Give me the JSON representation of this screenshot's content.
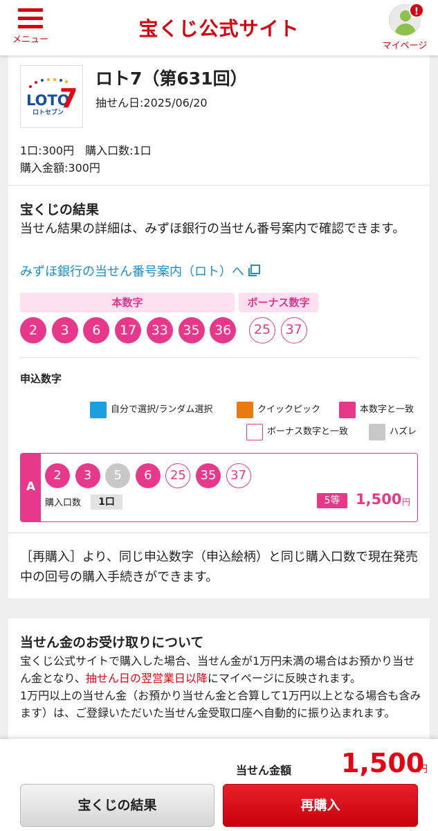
{
  "header": {
    "menu_label": "メニュー",
    "site_title": "宝くじ公式サイト",
    "mypage_label": "マイページ",
    "notification_badge": "!",
    "brand_color": "#d7000f"
  },
  "product": {
    "logo_text": "LOTO7",
    "logo_subtext": "ロトセブン",
    "title": "ロト7（第631回）",
    "draw_date": "抽せん日:2025/06/20",
    "price_line1": "1口:300円　購入口数:1口",
    "price_line2": "購入金額:300円"
  },
  "result": {
    "section_title": "宝くじの結果",
    "description": "当せん結果の詳細は、みずほ銀行の当せん番号案内で確認できます。",
    "link_text": "みずほ銀行の当せん番号案内（ロト）へ",
    "main_label": "本数字",
    "bonus_label": "ボーナス数字",
    "main_numbers": [
      "2",
      "3",
      "6",
      "17",
      "33",
      "35",
      "36"
    ],
    "bonus_numbers": [
      "25",
      "37"
    ]
  },
  "application": {
    "title": "申込数字",
    "legend": [
      {
        "label": "自分で選択/ランダム選択",
        "color": "#1a9fe0",
        "style": "fill"
      },
      {
        "label": "クイックピック",
        "color": "#e87a10",
        "style": "fill"
      },
      {
        "label": "本数字と一致",
        "color": "#e8388c",
        "style": "fill"
      },
      {
        "label": "ボーナス数字と一致",
        "color": "#e8388c",
        "style": "outline"
      },
      {
        "label": "ハズレ",
        "color": "#c8c8c8",
        "style": "fill"
      }
    ],
    "row": {
      "letter": "A",
      "numbers": [
        {
          "n": "2",
          "status": "main"
        },
        {
          "n": "3",
          "status": "main"
        },
        {
          "n": "5",
          "status": "miss"
        },
        {
          "n": "6",
          "status": "main"
        },
        {
          "n": "25",
          "status": "bonus"
        },
        {
          "n": "35",
          "status": "main"
        },
        {
          "n": "37",
          "status": "bonus"
        }
      ],
      "qty_label": "購入口数",
      "qty_value": "1口",
      "rank": "5等",
      "prize": "1,500",
      "prize_unit": "円"
    },
    "repurchase_note": "［再購入］より、同じ申込数字（申込絵柄）と同じ購入口数で現在発売中の回号の購入手続きができます。"
  },
  "receipt": {
    "title": "当せん金のお受け取りについて",
    "para1_a": "宝くじ公式サイトで購入した場合、当せん金が1万円未満の場合はお預かり当せん金となり、",
    "para1_red": "抽せん日の翌営業日以降",
    "para1_b": "にマイページに反映されます。",
    "para2": "1万円以上の当せん金（お預かり当せん金と合算して1万円以上となる場合も含みます）は、ご登録いただいた当せん金受取口座へ自動的に振り込まれます。"
  },
  "footer": {
    "win_label": "当せん金額",
    "win_amount": "1,500",
    "win_unit": "円",
    "result_button": "宝くじの結果",
    "rebuy_button": "再購入"
  }
}
